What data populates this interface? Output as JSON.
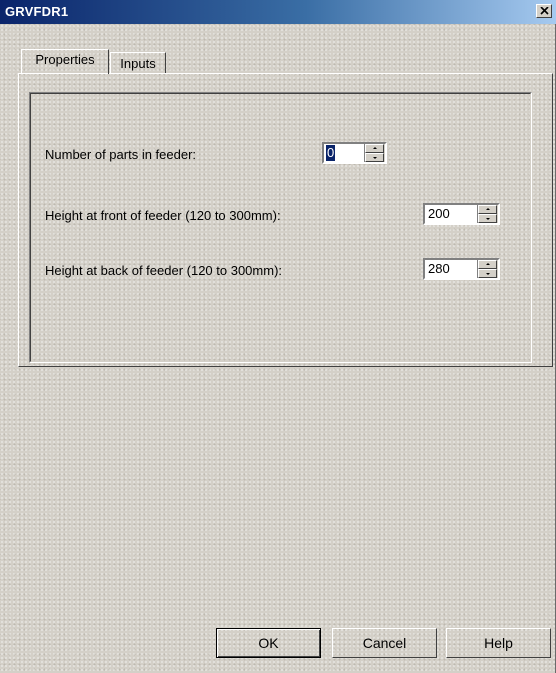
{
  "window": {
    "title": "GRVFDR1",
    "close_glyph": "✕"
  },
  "tabs": [
    {
      "label": "Properties",
      "active": true
    },
    {
      "label": "Inputs",
      "active": false
    }
  ],
  "fields": {
    "parts": {
      "label": "Number of parts in feeder:",
      "value": "0"
    },
    "front": {
      "label": "Height at front of feeder (120 to 300mm):",
      "value": "200"
    },
    "back": {
      "label": "Height at back of feeder  (120 to 300mm):",
      "value": "280"
    }
  },
  "buttons": {
    "ok": "OK",
    "cancel": "Cancel",
    "help": "Help"
  },
  "colors": {
    "title_start": "#0a246a",
    "title_end": "#a6caf0",
    "face": "#d4d0c8",
    "selection": "#0a246a"
  }
}
